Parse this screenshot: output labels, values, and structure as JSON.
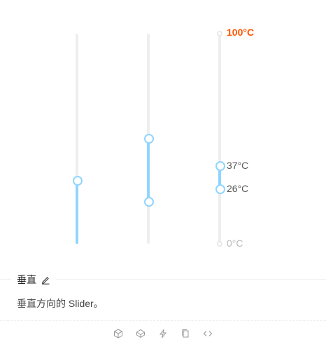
{
  "sliders": [
    {
      "name": "single",
      "value": 0.3
    },
    {
      "name": "range",
      "range": [
        0.2,
        0.5
      ]
    },
    {
      "name": "marks-range",
      "range": [
        0.26,
        0.37
      ],
      "marks": [
        {
          "value": "100",
          "label": "100°C",
          "style": "hot"
        },
        {
          "value": "37",
          "label": "37°C",
          "style": "mid"
        },
        {
          "value": "26",
          "label": "26°C",
          "style": "mid"
        },
        {
          "value": "0",
          "label": "0°C",
          "style": "dim"
        }
      ]
    }
  ],
  "section": {
    "title": "垂直",
    "description": "垂直方向的 Slider。"
  },
  "toolbar": {
    "icons": [
      "codesandbox-icon",
      "codepen-icon",
      "thunderbolt-icon",
      "copy-icon",
      "code-icon"
    ]
  },
  "colors": {
    "track": "#eeeeee",
    "fill": "#91d5ff",
    "hot_mark": "#ff5500"
  }
}
